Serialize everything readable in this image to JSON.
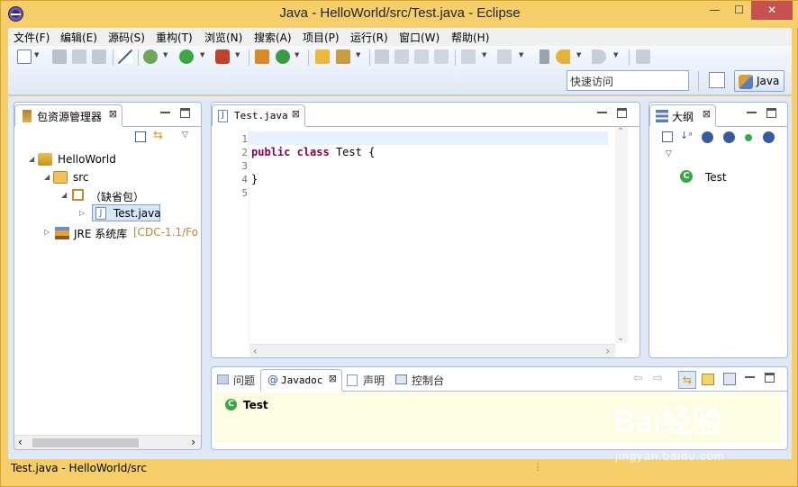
{
  "window": {
    "title": "Java - HelloWorld/src/Test.java - Eclipse",
    "min_label": "—",
    "max_label": "☐",
    "close_label": "✕"
  },
  "menu": {
    "items": [
      "文件(F)",
      "编辑(E)",
      "源码(S)",
      "重构(T)",
      "浏览(N)",
      "搜索(A)",
      "项目(P)",
      "运行(R)",
      "窗口(W)",
      "帮助(H)"
    ]
  },
  "toolbar": {
    "quick_access": "快速访问",
    "perspective_label": "Java"
  },
  "package_explorer": {
    "tab_label": "包资源管理器",
    "tree": {
      "project": "HelloWorld",
      "src": "src",
      "default_package": "（缺省包）",
      "file": "Test.java",
      "jre_label": "JRE 系统库",
      "jre_detail": "[CDC-1.1/Fo"
    }
  },
  "editor": {
    "tab_label": "Test.java",
    "line_numbers": [
      "1",
      "2",
      "3",
      "4",
      "5"
    ],
    "code": {
      "line2_kw1": "public",
      "line2_kw2": "class",
      "line2_rest": " Test {",
      "line4": "}"
    }
  },
  "outline": {
    "tab_label": "大纲",
    "item": "Test"
  },
  "bottom_panel": {
    "tabs": [
      "问题",
      "Javadoc",
      "声明",
      "控制台"
    ],
    "javadoc_title": "Test"
  },
  "status": {
    "text": "Test.java - HelloWorld/src"
  },
  "watermark": {
    "main": "Bai经验",
    "sub": "jingyan.baidu.com"
  },
  "colors": {
    "title_bg": "#f6cf6a",
    "keyword": "#7f0055",
    "javadoc_bg": "#fdfde4",
    "current_line": "#e8f2fe"
  }
}
